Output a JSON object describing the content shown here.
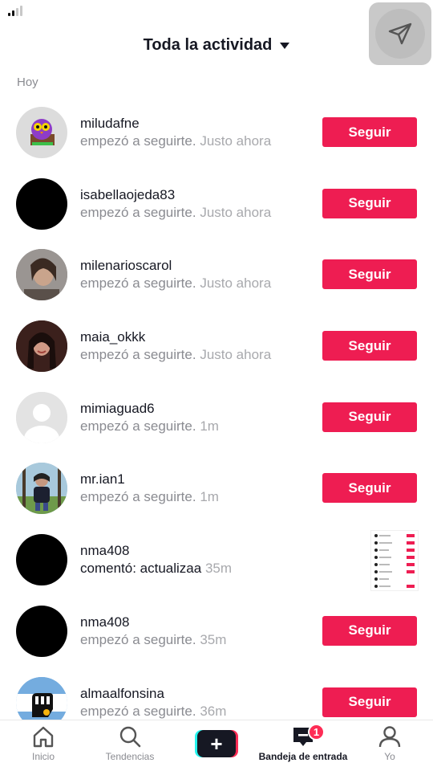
{
  "header": {
    "title": "Toda la actividad"
  },
  "section": {
    "label": "Hoy"
  },
  "accent": "#ee1d52",
  "activities": [
    {
      "username": "miludafne",
      "action": "empezó a seguirte.",
      "time": "Justo ahora",
      "button": "Seguir",
      "avatar": "owl"
    },
    {
      "username": "isabellaojeda83",
      "action": "empezó a seguirte.",
      "time": "Justo ahora",
      "button": "Seguir",
      "avatar": "black"
    },
    {
      "username": "milenarioscarol",
      "action": "empezó a seguirte.",
      "time": "Justo ahora",
      "button": "Seguir",
      "avatar": "photo"
    },
    {
      "username": "maia_okkk",
      "action": "empezó a seguirte.",
      "time": "Justo ahora",
      "button": "Seguir",
      "avatar": "photo-dark"
    },
    {
      "username": "mimiaguad6",
      "action": "empezó a seguirte.",
      "time": "1m",
      "button": "Seguir",
      "avatar": "default"
    },
    {
      "username": "mr.ian1",
      "action": "empezó a seguirte.",
      "time": "1m",
      "button": "Seguir",
      "avatar": "outdoor"
    },
    {
      "username": "nma408",
      "action": "comentó: actualizaa",
      "time": "35m",
      "button": "",
      "avatar": "black"
    },
    {
      "username": "nma408",
      "action": "empezó a seguirte.",
      "time": "35m",
      "button": "Seguir",
      "avatar": "black"
    },
    {
      "username": "almaalfonsina",
      "action": "empezó a seguirte.",
      "time": "36m",
      "button": "Seguir",
      "avatar": "fist"
    }
  ],
  "tabbar": {
    "home": "Inicio",
    "discover": "Tendencias",
    "inbox": "Bandeja de entrada",
    "inbox_badge": "1",
    "profile": "Yo"
  }
}
